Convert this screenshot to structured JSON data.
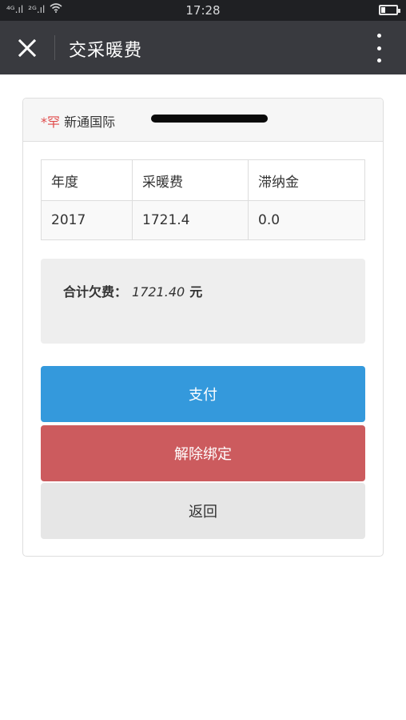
{
  "status_bar": {
    "signal_1": "⁴ᴳ.ıl",
    "signal_2": "²ᴳ.ıl",
    "wifi_icon": "wifi-icon",
    "time": "17:28",
    "battery_level": 0.25
  },
  "header": {
    "title": "交采暖费",
    "close_icon": "close-icon",
    "more_icon": "more-vertical-icon"
  },
  "account": {
    "name_mark": "*罕",
    "address": "新通国际"
  },
  "bill_table": {
    "headers": [
      "年度",
      "采暖费",
      "滞纳金"
    ],
    "rows": [
      [
        "2017",
        "1721.4",
        "0.0"
      ]
    ]
  },
  "total": {
    "label": "合计欠费：",
    "amount": "1721.40",
    "unit": "元"
  },
  "buttons": {
    "pay": "支付",
    "unbind": "解除绑定",
    "back": "返回"
  },
  "colors": {
    "pay": "#3499dc",
    "unbind": "#cc5b5e",
    "back": "#e6e6e6",
    "title_bar": "#393a3f",
    "name_mark": "#e04a4a"
  }
}
